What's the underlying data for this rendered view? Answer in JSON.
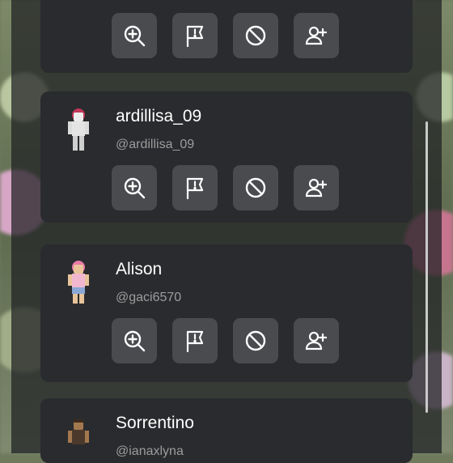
{
  "players": [
    {
      "name": "ardillisa_09",
      "handle": "@ardillisa_09"
    },
    {
      "name": "Alison",
      "handle": "@gaci6570"
    },
    {
      "name": "Sorrentino",
      "handle": "@ianaxlyna"
    }
  ],
  "actions": [
    "zoom-in-icon",
    "report-flag-icon",
    "block-icon",
    "add-friend-icon"
  ],
  "colors": {
    "panel": "#2a2b2e",
    "button": "#4a4b4f",
    "name": "#ffffff",
    "handle": "#9c9c9c"
  }
}
